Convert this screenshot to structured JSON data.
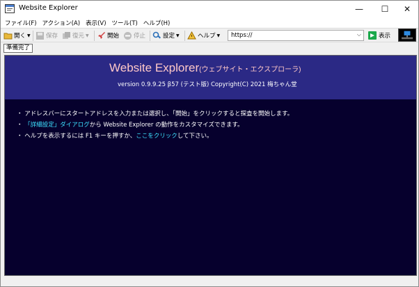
{
  "window": {
    "title": "Website Explorer",
    "minimize": "—",
    "maximize": "☐",
    "close": "✕"
  },
  "menu": {
    "items": [
      "ファイル(F)",
      "アクション(A)",
      "表示(V)",
      "ツール(T)",
      "ヘルプ(H)"
    ]
  },
  "toolbar": {
    "open_label": "開く",
    "save_label": "保存",
    "restore_label": "復元",
    "start_label": "開始",
    "stop_label": "停止",
    "settings_label": "設定",
    "help_label": "ヘルプ",
    "address_value": "https://",
    "show_label": "表示"
  },
  "status": {
    "ready": "準備完了"
  },
  "content": {
    "title": "Website Explorer",
    "title_sub": "(ウェブサイト・エクスプローラ)",
    "version": "version 0.9.9.25 β57 (テスト版) Copyright(C) 2021 梅ちゃん堂",
    "line1": "・ アドレスバーにスタートアドレスを入力または選択し、「開始」をクリックすると探査を開始します。",
    "line2_link": "「詳細設定」ダイアログ",
    "line2_pre": "・ ",
    "line2_post": "から Website Explorer の動作をカスタマイズできます。",
    "line3_pre": "・ ヘルプを表示するには F1 キーを押すか、",
    "line3_link": "ここをクリック",
    "line3_post": "して下さい。"
  },
  "colors": {
    "banner": "#2b2985",
    "content_bg": "#06002d",
    "title": "#ffc8c8",
    "link": "#3de2ff"
  }
}
